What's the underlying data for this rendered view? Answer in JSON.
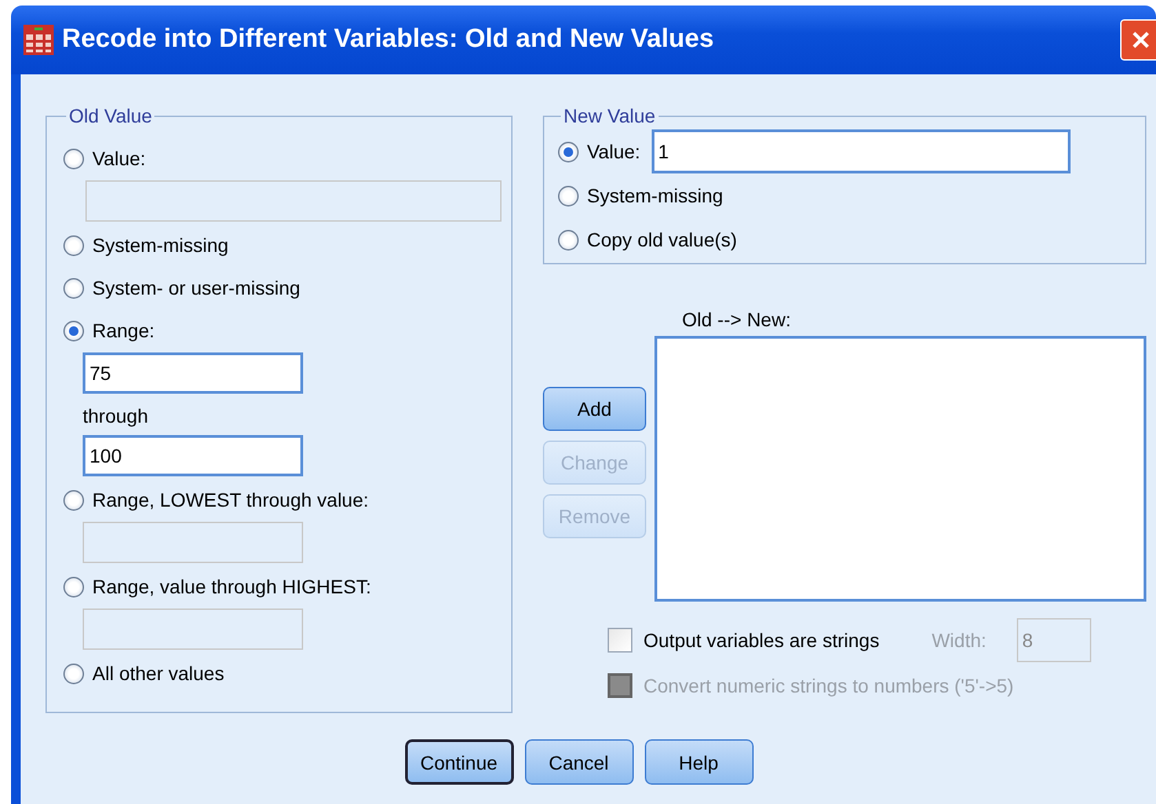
{
  "window": {
    "title": "Recode into Different Variables: Old and New Values"
  },
  "old_value": {
    "title": "Old Value",
    "options": [
      {
        "kind": "field",
        "label": "Value:",
        "selected": false,
        "fields": [
          {
            "disabled": true
          }
        ]
      },
      {
        "kind": "plain",
        "label": "System-missing",
        "selected": false
      },
      {
        "kind": "plain",
        "label": "System- or user-missing",
        "selected": false
      },
      {
        "kind": "range",
        "label": "Range:",
        "selected": true,
        "fields": [
          {
            "value": "75",
            "disabled": false
          },
          {
            "value": "100",
            "disabled": false
          }
        ],
        "separator": "through"
      },
      {
        "kind": "field",
        "label": "Range, LOWEST through value:",
        "selected": false,
        "fields": [
          {
            "disabled": true
          }
        ]
      },
      {
        "kind": "field",
        "label": "Range, value through HIGHEST:",
        "selected": false,
        "fields": [
          {
            "disabled": true
          }
        ]
      },
      {
        "kind": "plain",
        "label": "All other values",
        "selected": false
      }
    ]
  },
  "new_value": {
    "title": "New Value",
    "options": [
      {
        "kind": "field",
        "label": "Value:",
        "selected": true,
        "value": "1"
      },
      {
        "kind": "plain",
        "label": "System-missing",
        "selected": false
      },
      {
        "kind": "plain",
        "label": "Copy old value(s)",
        "selected": false
      }
    ]
  },
  "side_buttons": [
    {
      "label": "Add",
      "disabled": false
    },
    {
      "label": "Change",
      "disabled": true
    },
    {
      "label": "Remove",
      "disabled": true
    }
  ],
  "list": {
    "label": "Old --> New:"
  },
  "checkboxes": [
    {
      "label": "Output variables are strings",
      "checked": false,
      "disabled": false,
      "width_label": "Width:",
      "width_value": "8"
    },
    {
      "label": "Convert numeric strings to numbers ('5'->5)",
      "checked": false,
      "disabled": true
    }
  ],
  "footer_buttons": [
    {
      "label": "Continue",
      "focused": true
    },
    {
      "label": "Cancel",
      "focused": false
    },
    {
      "label": "Help",
      "focused": false
    }
  ]
}
